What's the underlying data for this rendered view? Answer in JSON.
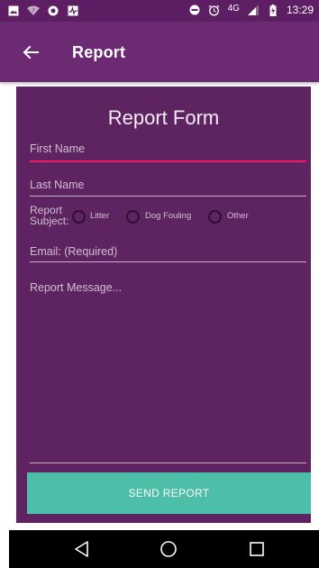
{
  "status_bar": {
    "time": "13:29",
    "network": "4G",
    "left_icons": [
      "image-icon",
      "wifi-question-icon",
      "circle-icon",
      "activity-icon"
    ],
    "right_icons": [
      "do-not-disturb-icon",
      "alarm-icon",
      "signal-icon",
      "battery-charging-icon"
    ]
  },
  "app_bar": {
    "back_icon": "arrow-left-icon",
    "title": "Report"
  },
  "form": {
    "title": "Report Form",
    "first_name_placeholder": "First Name",
    "last_name_placeholder": "Last Name",
    "subject_label_line1": "Report",
    "subject_label_line2": "Subject:",
    "subject_options": [
      "Litter",
      "Dog Fouling",
      "Other"
    ],
    "email_placeholder": "Email: (Required)",
    "message_placeholder": "Report Message..."
  },
  "send_button": "SEND REPORT",
  "nav_bar": [
    "back-triangle-icon",
    "home-circle-icon",
    "recents-square-icon"
  ],
  "colors": {
    "status_bar": "#5e1e63",
    "app_bar": "#6b2a72",
    "form_bg": "#5e2461",
    "accent_underline": "#e91e63",
    "send_button": "#4dbfa9"
  }
}
